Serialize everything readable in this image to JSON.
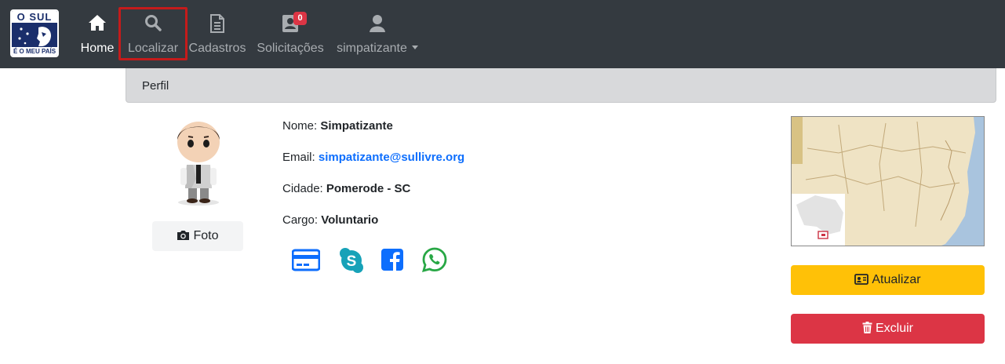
{
  "logo": {
    "top_text": "O SUL",
    "bottom_text": "É O MEU PAÍS"
  },
  "nav": {
    "home": "Home",
    "search": "Localizar",
    "records": "Cadastros",
    "requests": "Solicitações",
    "requests_badge": "0",
    "user": "simpatizante"
  },
  "card": {
    "header": "Perfil"
  },
  "profile": {
    "photo_button": "Foto",
    "name_label": "Nome:",
    "name_value": "Simpatizante",
    "email_label": "Email:",
    "email_value": "simpatizante@sullivre.org",
    "city_label": "Cidade:",
    "city_value": "Pomerode - SC",
    "role_label": "Cargo:",
    "role_value": "Voluntario"
  },
  "social_icons": [
    "credit-card-icon",
    "skype-icon",
    "facebook-icon",
    "whatsapp-icon"
  ],
  "actions": {
    "update": "Atualizar",
    "delete": "Excluir"
  },
  "colors": {
    "navbar": "#343a40",
    "link": "#0d6efd",
    "warning": "#ffc107",
    "danger": "#dc3545",
    "highlight_box": "#c41b1b"
  }
}
